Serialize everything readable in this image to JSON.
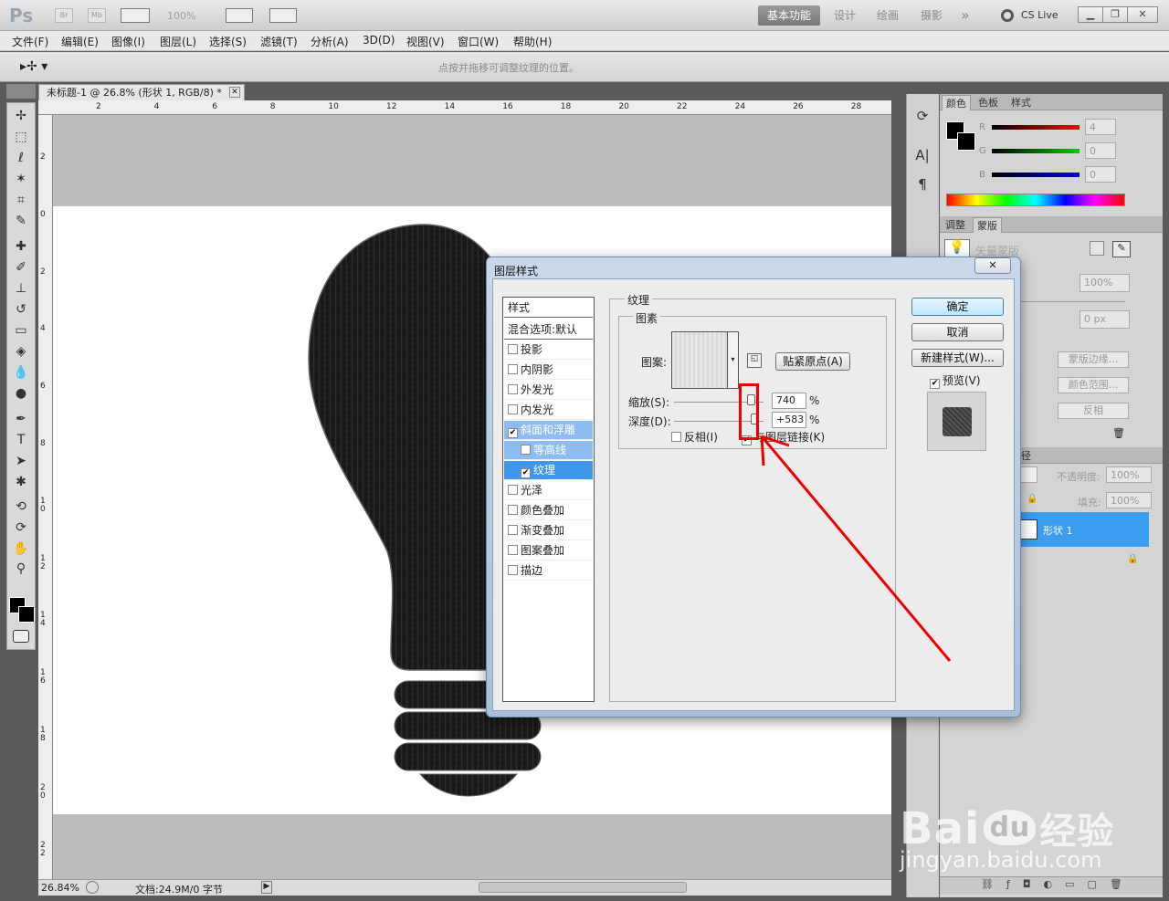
{
  "app": {
    "logo": "Ps",
    "bridge": "Br",
    "minibridge": "Mb",
    "zoom_select": "100%",
    "workspaces": [
      "基本功能",
      "设计",
      "绘画",
      "摄影"
    ],
    "more": "»",
    "cslive": "CS Live"
  },
  "menu": [
    "文件(F)",
    "编辑(E)",
    "图像(I)",
    "图层(L)",
    "选择(S)",
    "滤镜(T)",
    "分析(A)",
    "3D(D)",
    "视图(V)",
    "窗口(W)",
    "帮助(H)"
  ],
  "options": {
    "hint": "点按并拖移可调整纹理的位置。"
  },
  "document": {
    "tab_title": "未标题-1 @ 26.8% (形状 1, RGB/8) *",
    "hruler": [
      "2",
      "4",
      "6",
      "8",
      "10",
      "12",
      "14",
      "16",
      "18",
      "20",
      "22",
      "24",
      "26",
      "28"
    ],
    "vruler": [
      "2",
      "0",
      "2",
      "4",
      "6",
      "8",
      "1\n0",
      "1\n2",
      "1\n4",
      "1\n6",
      "1\n8",
      "2\n0",
      "2\n2"
    ],
    "zoom": "26.84%",
    "doc_info": "文档:24.9M/0 字节"
  },
  "color_panel": {
    "tabs": [
      "颜色",
      "色板",
      "样式"
    ],
    "r_label": "R",
    "g_label": "G",
    "b_label": "B",
    "r": "4",
    "g": "0",
    "b": "0"
  },
  "masks_panel": {
    "tabs": [
      "调整",
      "蒙版"
    ],
    "vector_mask": "矢量蒙版",
    "density": "100%",
    "feather": "0 px",
    "mask_edge": "蒙版边缘...",
    "color_range": "颜色范围...",
    "invert": "反相"
  },
  "layers_panel": {
    "tab": "径",
    "opacity_label": "不透明度:",
    "opacity": "100%",
    "fill_label": "填充:",
    "fill": "100%",
    "layers": [
      "形状 1"
    ]
  },
  "dialog": {
    "title": "图层样式",
    "styles_header": "样式",
    "blend_options": "混合选项:默认",
    "items": [
      {
        "label": "投影",
        "checked": false
      },
      {
        "label": "内阴影",
        "checked": false
      },
      {
        "label": "外发光",
        "checked": false
      },
      {
        "label": "内发光",
        "checked": false
      },
      {
        "label": "斜面和浮雕",
        "checked": true
      },
      {
        "label": "等高线",
        "checked": false
      },
      {
        "label": "纹理",
        "checked": true
      },
      {
        "label": "光泽",
        "checked": false
      },
      {
        "label": "颜色叠加",
        "checked": false
      },
      {
        "label": "渐变叠加",
        "checked": false
      },
      {
        "label": "图案叠加",
        "checked": false
      },
      {
        "label": "描边",
        "checked": false
      }
    ],
    "section_title": "纹理",
    "group_title": "图素",
    "pattern_label": "图案:",
    "snap_button": "贴紧原点(A)",
    "scale_label": "缩放(S):",
    "scale_value": "740",
    "depth_label": "深度(D):",
    "depth_value": "+583",
    "percent": "%",
    "invert_label": "反相(I)",
    "link_label": "与图层链接(K)",
    "ok": "确定",
    "cancel": "取消",
    "new_style": "新建样式(W)...",
    "preview": "预览(V)"
  },
  "watermark": {
    "brand": "Bai",
    "brand2": "du",
    "cn": "经验",
    "url": "jingyan.baidu.com"
  }
}
